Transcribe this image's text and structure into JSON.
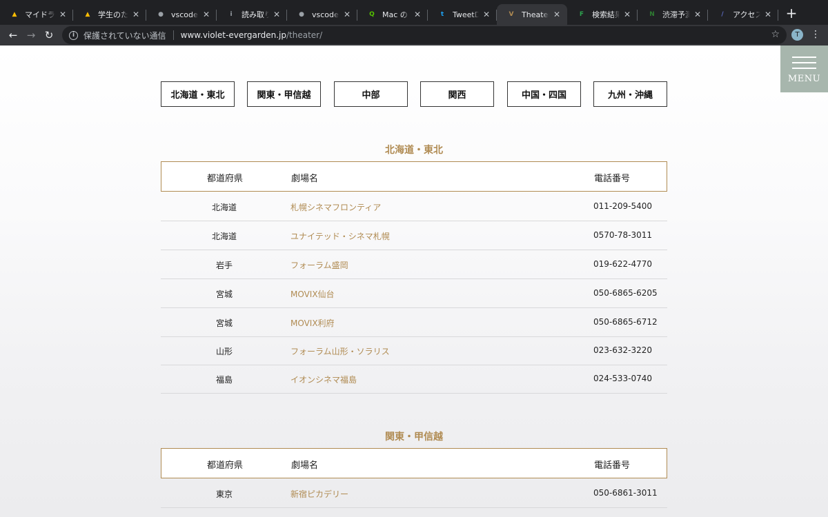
{
  "browser": {
    "tabs": [
      {
        "title": "マイドライブ",
        "favicon": "drive-icon",
        "color": "#fbbc04"
      },
      {
        "title": "学生のための",
        "favicon": "drive-icon",
        "color": "#fbbc04"
      },
      {
        "title": "vscode-cpp",
        "favicon": "github-icon",
        "color": "#9aa0a6"
      },
      {
        "title": "読み取り専用",
        "favicon": "info-circle-icon",
        "color": "#9aa0a6"
      },
      {
        "title": "vscode-cpp",
        "favicon": "github-icon",
        "color": "#9aa0a6"
      },
      {
        "title": "Mac の Visual",
        "favicon": "qiita-icon",
        "color": "#55c500"
      },
      {
        "title": "TweetDeck",
        "favicon": "twitter-icon",
        "color": "#1da1f2"
      },
      {
        "title": "Theater | ",
        "favicon": "violet-icon",
        "color": "#b08b52"
      },
      {
        "title": "検索結果 | ",
        "favicon": "flag-icon",
        "color": "#2ea44f"
      },
      {
        "title": "渋滞予測 | ",
        "favicon": "nexco-icon",
        "color": "#2e7d32"
      },
      {
        "title": "アクセスマップ",
        "favicon": "slash-icon",
        "color": "#5c6bc0"
      }
    ],
    "new_tab": "+",
    "back": "←",
    "forward": "→",
    "reload": "↻",
    "insecure_label": "保護されていない通信",
    "url_host": "www.violet-evergarden.jp",
    "url_path": "/theater/",
    "star": "☆",
    "avatar_letter": "T",
    "menu_kebab": "⋮"
  },
  "menu": {
    "label": "MENU"
  },
  "regions": [
    "北海道・東北",
    "関東・甲信越",
    "中部",
    "関西",
    "中国・四国",
    "九州・沖縄"
  ],
  "headers": {
    "pref": "都道府県",
    "name": "劇場名",
    "tel": "電話番号"
  },
  "sections": [
    {
      "title": "北海道・東北",
      "rows": [
        {
          "pref": "北海道",
          "name": "札幌シネマフロンティア",
          "tel": "011-209-5400"
        },
        {
          "pref": "北海道",
          "name": "ユナイテッド・シネマ札幌",
          "tel": "0570-78-3011"
        },
        {
          "pref": "岩手",
          "name": "フォーラム盛岡",
          "tel": "019-622-4770"
        },
        {
          "pref": "宮城",
          "name": "MOVIX仙台",
          "tel": "050-6865-6205"
        },
        {
          "pref": "宮城",
          "name": "MOVIX利府",
          "tel": "050-6865-6712"
        },
        {
          "pref": "山形",
          "name": "フォーラム山形・ソラリス",
          "tel": "023-632-3220"
        },
        {
          "pref": "福島",
          "name": "イオンシネマ福島",
          "tel": "024-533-0740"
        }
      ]
    },
    {
      "title": "関東・甲信越",
      "rows": [
        {
          "pref": "東京",
          "name": "新宿ピカデリー",
          "tel": "050-6861-3011"
        }
      ]
    }
  ],
  "colors": {
    "accent": "#b08b52",
    "menu_bg": "#a7b6ad"
  }
}
